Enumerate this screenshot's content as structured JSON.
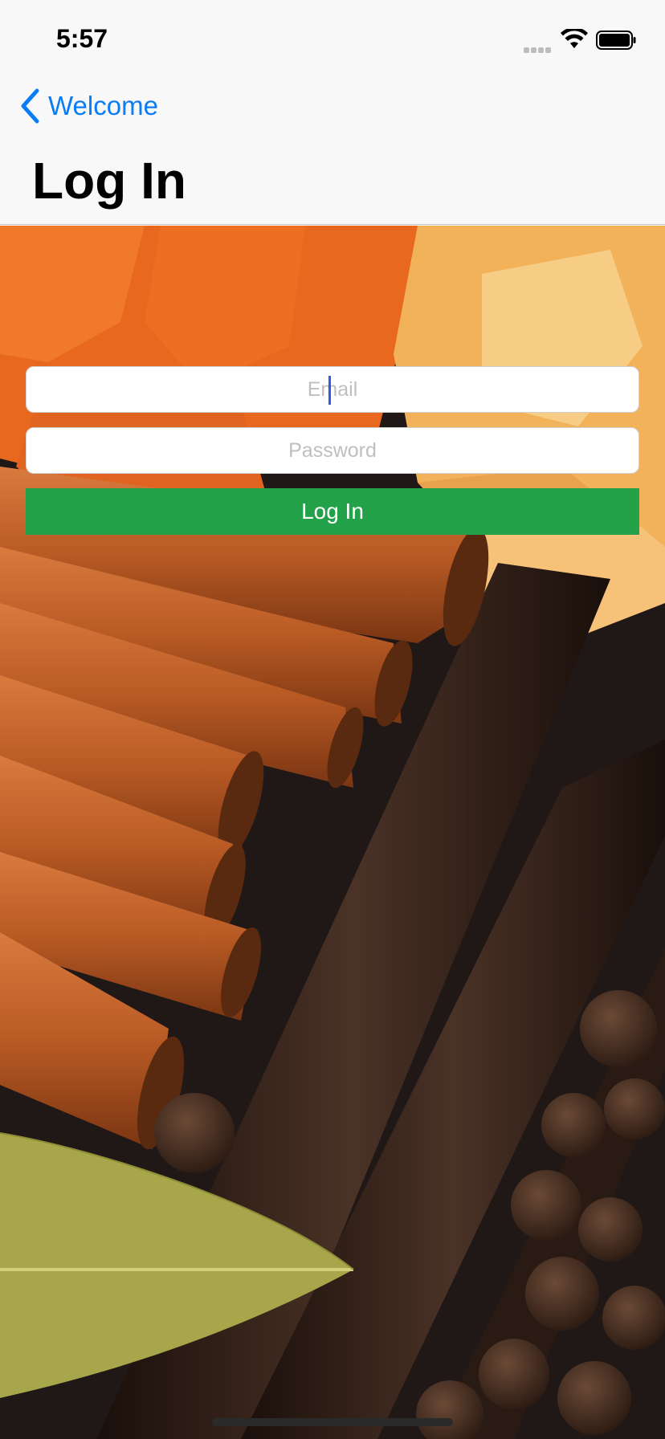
{
  "status_bar": {
    "time": "5:57",
    "icons": [
      "cellular-signal-icon",
      "wifi-icon",
      "battery-icon"
    ]
  },
  "nav": {
    "back_label": "Welcome",
    "title": "Log In"
  },
  "form": {
    "email": {
      "value": "",
      "placeholder": "Email"
    },
    "password": {
      "value": "",
      "placeholder": "Password"
    },
    "submit_label": "Log In"
  },
  "colors": {
    "accent_blue": "#0a7cf5",
    "button_green": "#24a24a",
    "nav_background": "#f8f8f8"
  }
}
